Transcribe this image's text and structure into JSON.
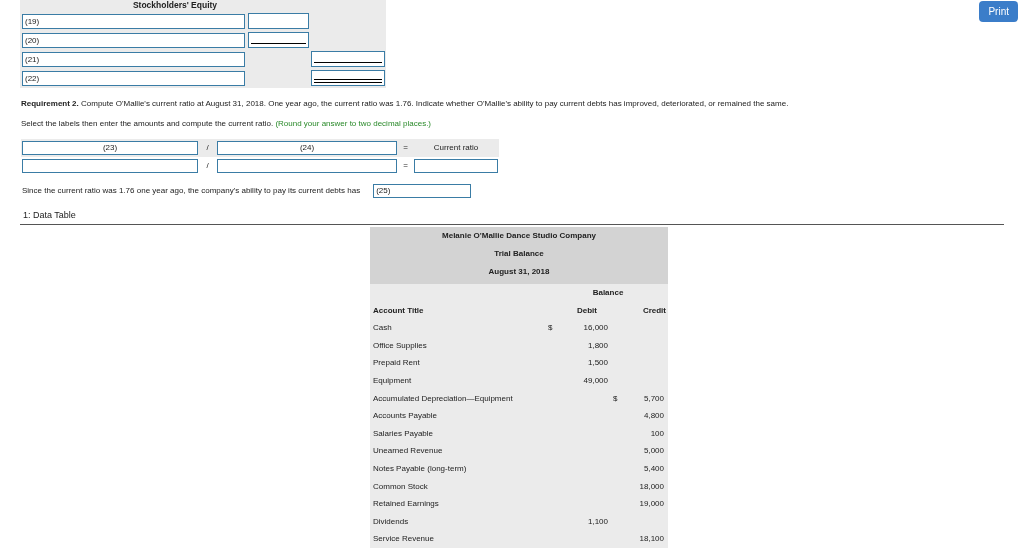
{
  "print_button": "Print",
  "equity": {
    "title": "Stockholders' Equity",
    "rows": [
      {
        "label": "(19)",
        "kind": "subtotal",
        "underlined": false,
        "double_underlined": false
      },
      {
        "label": "(20)",
        "kind": "subtotal",
        "underlined": true,
        "double_underlined": false
      },
      {
        "label": "(21)",
        "kind": "total",
        "underlined": true,
        "double_underlined": false
      },
      {
        "label": "(22)",
        "kind": "total",
        "underlined": false,
        "double_underlined": true
      }
    ]
  },
  "requirement": {
    "heading": "Requirement 2.",
    "text": "Compute O'Mallie's current ratio at August 31, 2018. One year ago, the current ratio was 1.76. Indicate whether   O'Mallie's ability to pay current debts has improved, deteriorated, or remained the same."
  },
  "instruction": {
    "text": "Select the labels then enter the amounts and compute the current ratio.",
    "hint": "(Round your answer to two decimal places.)"
  },
  "ratio": {
    "numerator": "(23)",
    "divide": "/",
    "denominator": "(24)",
    "equals": "=",
    "result": "Current ratio",
    "row2_divide": "/",
    "row2_equals": "="
  },
  "conclusion": {
    "text": "Since the current ratio was 1.76 one year ago, the company's ability to pay its current debts has",
    "answer": "(25)"
  },
  "data_table": {
    "title": "1: Data Table",
    "company": "Melanie O'Mallie Dance Studio Company",
    "statement": "Trial Balance",
    "date": "August 31, 2018",
    "group_header": "Balance",
    "columns": [
      "Account Title",
      "Debit",
      "Credit"
    ],
    "rows": [
      {
        "account": "Cash",
        "debit_sign": "$",
        "debit": "16,000"
      },
      {
        "account": "Office Supplies",
        "debit": "1,800"
      },
      {
        "account": "Prepaid Rent",
        "debit": "1,500"
      },
      {
        "account": "Equipment",
        "debit": "49,000"
      },
      {
        "account": "Accumulated Depreciation—Equipment",
        "credit_sign": "$",
        "credit": "5,700"
      },
      {
        "account": "Accounts Payable",
        "credit": "4,800"
      },
      {
        "account": "Salaries Payable",
        "credit": "100"
      },
      {
        "account": "Unearned Revenue",
        "credit": "5,000"
      },
      {
        "account": "Notes Payable (long-term)",
        "credit": "5,400"
      },
      {
        "account": "Common Stock",
        "credit": "18,000"
      },
      {
        "account": "Retained Earnings",
        "credit": "19,000"
      },
      {
        "account": "Dividends",
        "debit": "1,100"
      },
      {
        "account": "Service Revenue",
        "credit": "18,100"
      }
    ]
  }
}
